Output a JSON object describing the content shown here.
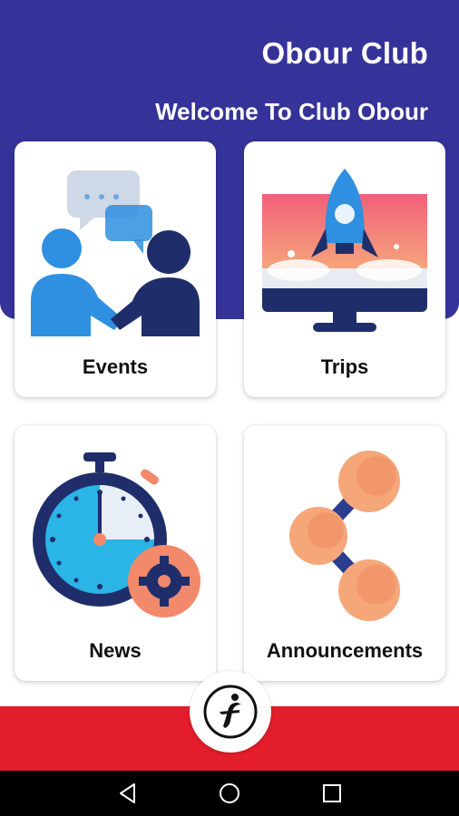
{
  "header": {
    "title": "Obour Club",
    "welcome": "Welcome To Club Obour",
    "background_color": "#353399"
  },
  "cards": [
    {
      "label": "Events",
      "icon": "handshake-chat-icon"
    },
    {
      "label": "Trips",
      "icon": "rocket-monitor-icon"
    },
    {
      "label": "News",
      "icon": "stopwatch-gear-icon"
    },
    {
      "label": "Announcements",
      "icon": "share-nodes-icon"
    }
  ],
  "bottom_bar": {
    "color": "#e31d2b",
    "center_button_icon": "club-logo-icon"
  },
  "system_nav": {
    "buttons": [
      "back-icon",
      "home-icon",
      "recents-icon"
    ]
  }
}
